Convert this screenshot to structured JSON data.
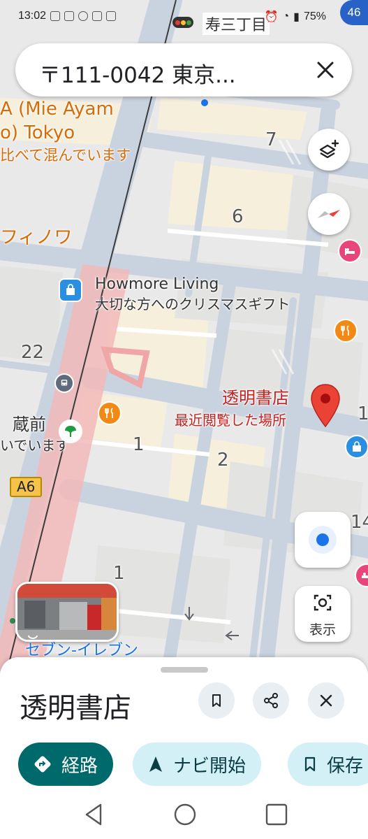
{
  "status_bar": {
    "time": "13:02",
    "battery": "75%",
    "network_badge": "46"
  },
  "search": {
    "query": "〒111-0042 東京..."
  },
  "map": {
    "town_label": "寿三丁目",
    "poi_mie_ayam_line1": "A (Mie Ayam",
    "poi_mie_ayam_line2": "o) Tokyo",
    "poi_mie_ayam_line3": "比べて混んでいます",
    "poi_fino": "フィノワ",
    "poi_howmore_name": "Howmore Living",
    "poi_howmore_sub": "大切な方へのクリスマスギフト",
    "selected_place_name": "透明書店",
    "selected_place_sub": "最近閲覧した場所",
    "station_name": "蔵前",
    "station_sub": "いでいます",
    "road_sign": "A6",
    "seven_eleven": "セブン-イレブン",
    "block_numbers": [
      "7",
      "6",
      "22",
      "1",
      "2",
      "1",
      "14",
      "1"
    ],
    "lens_button_label": "表示"
  },
  "place_sheet": {
    "title": "透明書店",
    "directions_label": "経路",
    "start_nav_label": "ナビ開始",
    "save_label": "保存"
  },
  "colors": {
    "accent_teal": "#00696b",
    "chip_light": "#d2f0f5",
    "pin_red": "#ea4335",
    "orange_poi": "#f08a14",
    "blue_poi": "#2a8fe0",
    "pink_poi": "#e8467b"
  }
}
